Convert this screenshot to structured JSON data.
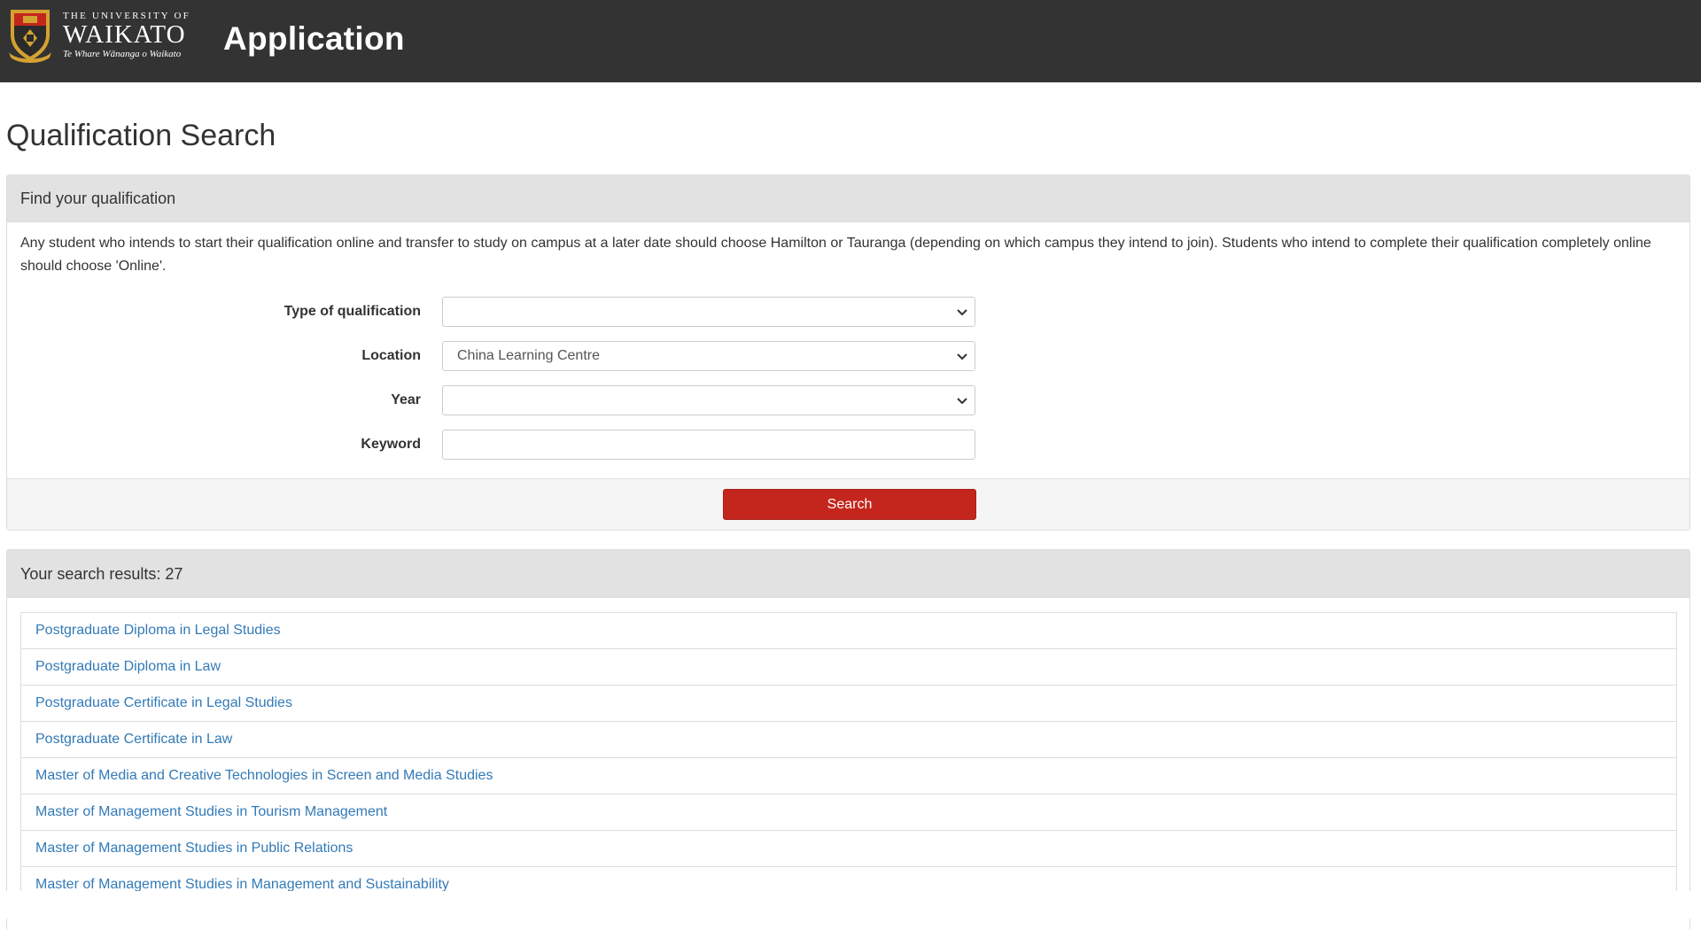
{
  "header": {
    "logo": {
      "line1": "THE UNIVERSITY OF",
      "line2": "WAIKATO",
      "line3": "Te Whare Wānanga o Waikato"
    },
    "app_title": "Application",
    "colors": {
      "bar": "#333333",
      "crest_gold": "#d4a230",
      "crest_red": "#c4261d"
    }
  },
  "page": {
    "title": "Qualification Search"
  },
  "search_panel": {
    "heading": "Find your qualification",
    "intro": "Any student who intends to start their qualification online and transfer to study on campus at a later date should choose Hamilton or Tauranga (depending on which campus they intend to join). Students who intend to complete their qualification completely online should choose 'Online'.",
    "fields": {
      "type": {
        "label": "Type of qualification",
        "value": ""
      },
      "location": {
        "label": "Location",
        "value": "China Learning Centre"
      },
      "year": {
        "label": "Year",
        "value": ""
      },
      "keyword": {
        "label": "Keyword",
        "value": ""
      }
    },
    "search_label": "Search",
    "search_color": "#c4261d"
  },
  "results": {
    "heading": "Your search results: 27",
    "items": [
      "Postgraduate Diploma in Legal Studies",
      "Postgraduate Diploma in Law",
      "Postgraduate Certificate in Legal Studies",
      "Postgraduate Certificate in Law",
      "Master of Media and Creative Technologies in Screen and Media Studies",
      "Master of Management Studies in Tourism Management",
      "Master of Management Studies in Public Relations",
      "Master of Management Studies in Management and Sustainability"
    ],
    "link_color": "#337ab7"
  }
}
